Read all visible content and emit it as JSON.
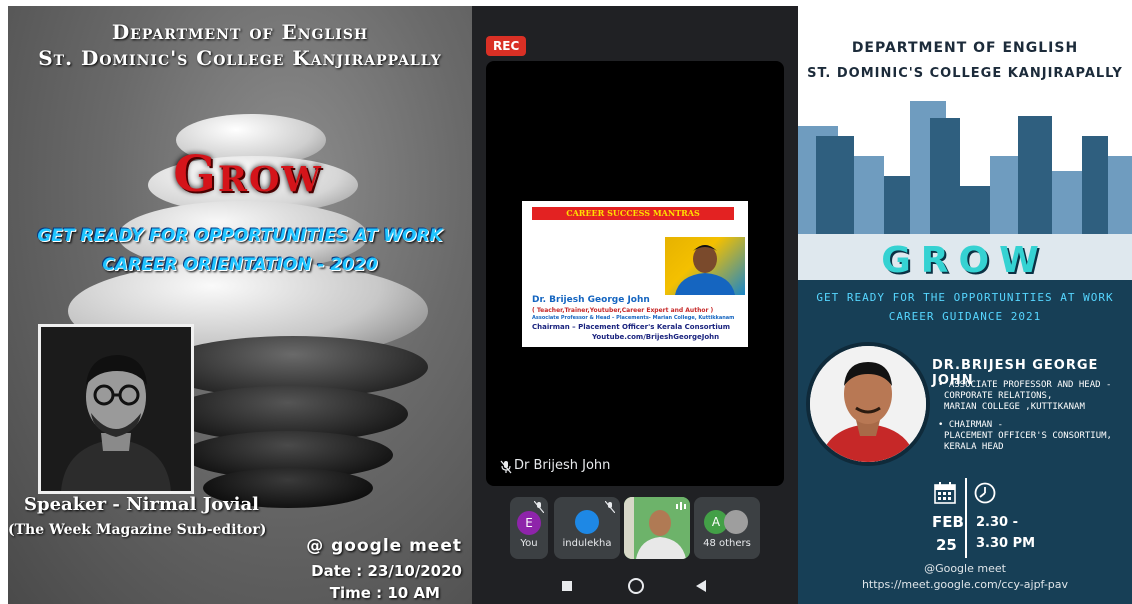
{
  "left_poster": {
    "department": "Department of English",
    "college": "St. Dominic's College Kanjirappally",
    "title": "Grow",
    "tagline1": "GET READY FOR OPPORTUNITIES AT WORK",
    "tagline2": "CAREER ORIENTATION - 2020",
    "speaker": "Speaker - Nirmal Jovial",
    "speaker_role": "(The Week Magazine Sub-editor)",
    "platform": "@ google meet",
    "date": "Date : 23/10/2020",
    "time": "Time : 10 AM"
  },
  "meet_call": {
    "rec_badge": "REC",
    "speaker_name": "Dr Brijesh John",
    "slide": {
      "header": "CAREER SUCCESS MANTRAS",
      "name": "Dr. Brijesh George John",
      "line1": "( Teacher,Trainer,Youtuber,Career Expert and Author )",
      "line2": "Associate Professor & Head – Placements- Marian College, Kuttikkanam",
      "line3": "Chairman – Placement Officer's Kerala Consortium",
      "line4": "Youtube.com/BrijeshGeorgeJohn"
    },
    "participants": [
      {
        "initial": "E",
        "label": "You",
        "color": "#8e24aa"
      },
      {
        "initial": "",
        "label": "indulekha",
        "color": "#1e88e5"
      },
      {
        "initial": "",
        "label": "",
        "color": "#4caf50"
      },
      {
        "initial": "A",
        "label": "48 others",
        "color": "#43a047"
      }
    ],
    "icons": [
      "mic-off-icon",
      "square-nav-icon",
      "circle-nav-icon",
      "triangle-back-icon"
    ]
  },
  "right_poster": {
    "department": "DEPARTMENT OF ENGLISH",
    "college": "ST. DOMINIC'S COLLEGE KANJIRAPALLY",
    "title": "GROW",
    "tagline1": "GET READY FOR THE OPPORTUNITIES AT WORK",
    "tagline2": "CAREER GUIDANCE 2021",
    "speaker_name": "DR.BRIJESH GEORGE JOHN",
    "bio1": "• ASSOCIATE PROFESSOR AND HEAD -",
    "bio2": "CORPORATE RELATIONS,",
    "bio3": "MARIAN COLLEGE ,KUTTIKANAM",
    "bio4": "• CHAIRMAN -",
    "bio5": "PLACEMENT OFFICER'S CONSORTIUM,",
    "bio6": "KERALA HEAD",
    "month": "FEB",
    "day": "25",
    "time_start": "2.30 -",
    "time_end": "3.30 PM",
    "platform": "@Google meet",
    "url": "https://meet.google.com/ccy-ajpf-pav",
    "colors": {
      "band": "#173f56",
      "title": "#35d2d2",
      "tagline": "#56d6ff"
    }
  }
}
